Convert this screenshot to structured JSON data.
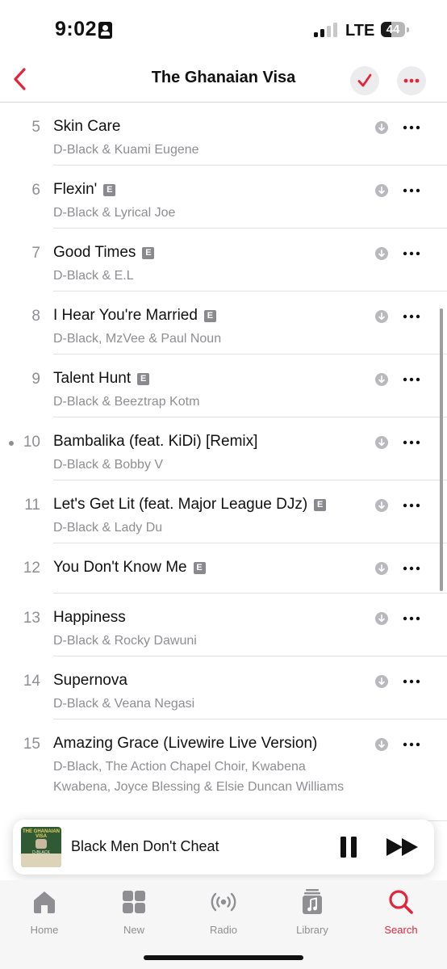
{
  "status_bar": {
    "time": "9:02",
    "network": "LTE",
    "battery": "44"
  },
  "nav": {
    "title": "The Ghanaian Visa"
  },
  "tracks": [
    {
      "number": "5",
      "title": "Skin Care",
      "explicit": false,
      "artist": "D-Black & Kuami Eugene"
    },
    {
      "number": "6",
      "title": "Flexin'",
      "explicit": true,
      "artist": "D-Black & Lyrical Joe"
    },
    {
      "number": "7",
      "title": "Good Times",
      "explicit": true,
      "artist": "D-Black & E.L"
    },
    {
      "number": "8",
      "title": "I Hear You're Married",
      "explicit": true,
      "artist": "D-Black, MzVee & Paul Noun"
    },
    {
      "number": "9",
      "title": "Talent Hunt",
      "explicit": true,
      "artist": "D-Black & Beeztrap Kotm"
    },
    {
      "number": "10",
      "title": "Bambalika (feat. KiDi) [Remix]",
      "explicit": false,
      "artist": "D-Black & Bobby V",
      "now_playing_dot": true
    },
    {
      "number": "11",
      "title": "Let's Get Lit (feat. Major League DJz)",
      "explicit": true,
      "artist": "D-Black & Lady Du"
    },
    {
      "number": "12",
      "title": "You Don't Know Me",
      "explicit": true,
      "artist": ""
    },
    {
      "number": "13",
      "title": "Happiness",
      "explicit": false,
      "artist": "D-Black & Rocky Dawuni"
    },
    {
      "number": "14",
      "title": "Supernova",
      "explicit": false,
      "artist": "D-Black & Veana Negasi"
    },
    {
      "number": "15",
      "title": "Amazing Grace (Livewire Live Version)",
      "explicit": false,
      "artist": "D-Black, The Action Chapel Choir, Kwabena Kwabena, Joyce Blessing & Elsie Duncan Williams"
    }
  ],
  "explicit_badge": "E",
  "now_playing": {
    "title": "Black Men Don't Cheat",
    "artwork_title": "THE GHANAIAN VISA",
    "artwork_artist": "D-BLACK"
  },
  "tabs": [
    {
      "label": "Home",
      "icon": "home-icon"
    },
    {
      "label": "New",
      "icon": "grid-icon"
    },
    {
      "label": "Radio",
      "icon": "radio-icon"
    },
    {
      "label": "Library",
      "icon": "library-icon"
    },
    {
      "label": "Search",
      "icon": "search-icon",
      "active": true
    }
  ],
  "colors": {
    "accent": "#e5243b",
    "secondary_text": "#8e8e93",
    "artwork_green": "#2f5a33"
  }
}
